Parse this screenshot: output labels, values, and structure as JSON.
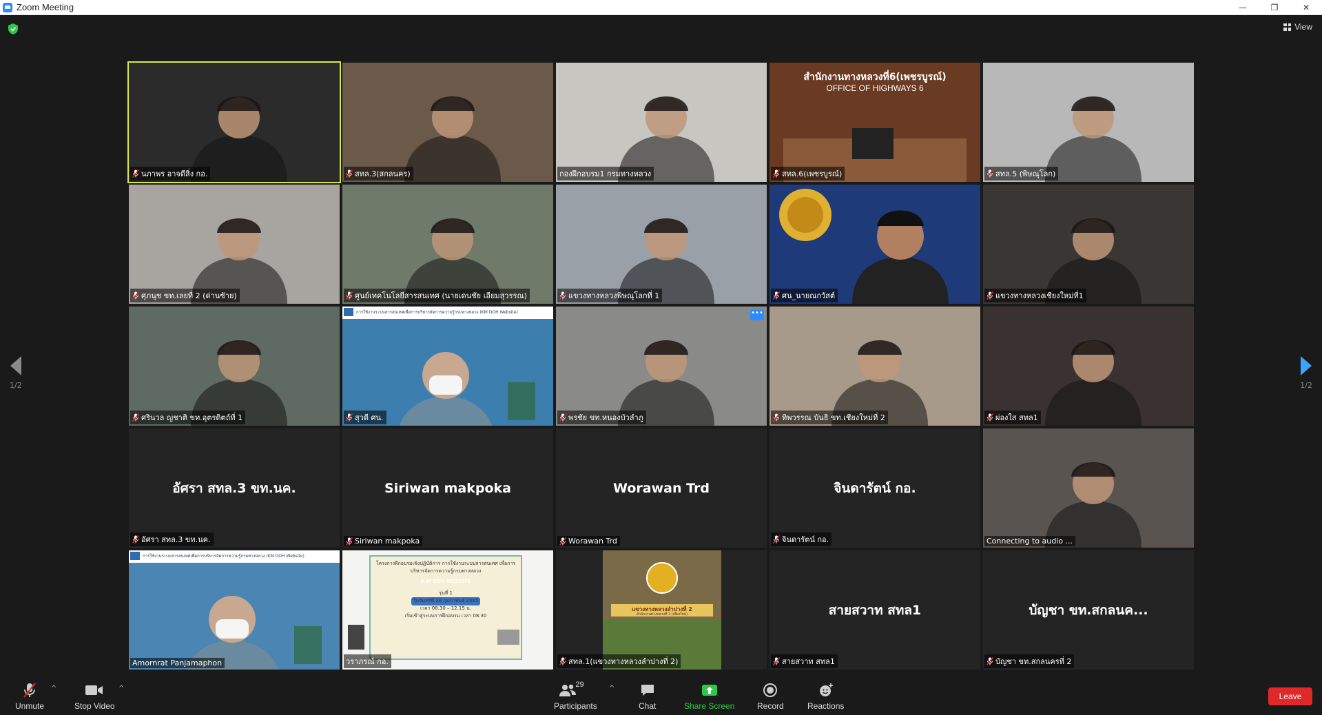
{
  "window": {
    "title": "Zoom Meeting",
    "minimize": "—",
    "restore": "❐",
    "close": "✕"
  },
  "header": {
    "view_label": "View"
  },
  "pager": {
    "left_label": "1/2",
    "right_label": "1/2"
  },
  "tiles": [
    {
      "name": "นภาพร อาจดีสิ่ง กอ.",
      "muted": true,
      "bg": "#2b2b2b",
      "active": true
    },
    {
      "name": "สทล.3(สกลนคร)",
      "muted": true,
      "bg": "#6b5a4a"
    },
    {
      "name": "กองฝึกอบรม1 กรมทางหลวง",
      "muted": false,
      "bg": "#c8c6c0"
    },
    {
      "name": "สทล.6(เพชรบูรณ์)",
      "muted": true,
      "bg": "#6a3a22",
      "sign_line1": "สำนักงานทางหลวงที่6(เพชรบูรณ์)",
      "sign_line2": "OFFICE OF HIGHWAYS 6"
    },
    {
      "name": "สทล.5 (พิษณุโลก)",
      "muted": true,
      "bg": "#b8b8b8"
    },
    {
      "name": "ศุภนุช ขท.เลยที่ 2 (ด่านซ้าย)",
      "muted": true,
      "bg": "#a8a4a0"
    },
    {
      "name": "ศูนย์เทคโนโลยีสารสนเทศ (นายเดนชัย เอียมสุวรรณ)",
      "muted": true,
      "bg": "#6f7a6a"
    },
    {
      "name": "แขวงทางหลวงพิษณุโลกที่ 1",
      "muted": true,
      "bg": "#9aa0a8"
    },
    {
      "name": "ศน_นายณกวัสต์",
      "muted": true,
      "bg": "#1f3a78"
    },
    {
      "name": "แขวงทางหลวงเชียงใหม่ที่1",
      "muted": true,
      "bg": "#3a3634"
    },
    {
      "name": "ศรินวล ญชาติ ขท.อุตรดิตถ์ที่ 1",
      "muted": true,
      "bg": "#5f6b62"
    },
    {
      "name": "สุวดี ศน.",
      "muted": true,
      "bg": "#3c7fae",
      "banner": "การใช้งานระบบสารสนเทศเพื่อการบริหารจัดการความรู้กรมทางหลวง (KM DOH Website)"
    },
    {
      "name": "พรชัย ขท.หนองบัวลำภู",
      "muted": true,
      "bg": "#8a8a88",
      "more": true
    },
    {
      "name": "ทิพวรรณ บันธิ ขท.เชียงใหม่ที่ 2",
      "muted": true,
      "bg": "#a89a8a"
    },
    {
      "name": "ผ่องใส สทล1",
      "muted": true,
      "bg": "#3a3230"
    },
    {
      "name": "อัศรา สทล.3 ขท.นค.",
      "muted": true,
      "bg": "#242424",
      "center": "อัศรา สทล.3 ขท.นค."
    },
    {
      "name": "Siriwan makpoka",
      "muted": true,
      "bg": "#242424",
      "center": "Siriwan makpoka"
    },
    {
      "name": "Worawan Trd",
      "muted": true,
      "bg": "#242424",
      "center": "Worawan Trd"
    },
    {
      "name": "จินดารัตน์ กอ.",
      "muted": true,
      "bg": "#242424",
      "center": "จินดารัตน์ กอ."
    },
    {
      "name": "Connecting to audio ...",
      "muted": false,
      "bg": "#5a5450"
    },
    {
      "name": "Amornrat Panjamaphon",
      "muted": false,
      "bg": "#4a85b4",
      "banner": "การใช้งานระบบสารสนเทศเพื่อการบริหารจัดการความรู้กรมทางหลวง (KM DOH Website)"
    },
    {
      "name": "วราภรณ์ กอ.",
      "muted": false,
      "bg": "#f4f4f2",
      "poster_title": "โครงการฝึกอบรมเชิงปฏิบัติการ การใช้งานระบบสารสนเทศ เพื่อการบริหารจัดการความรู้กรมทางหลวง",
      "poster_site": "K.M DOH WEBSITE",
      "poster_round": "รุ่นที่ 1",
      "poster_date": "วันจันทร์ที่ 28 กุมภาพันธ์ 2565",
      "poster_time": "เวลา 08.30 – 12.15 น.",
      "poster_join": "เริ่มเข้าสู่ระบบการฝึกอบรม เวลา 08.30"
    },
    {
      "name": "สทล.1(แขวงทางหลวงลำปางที่ 2)",
      "muted": true,
      "bg": "#242424",
      "lampang_title": "แขวงทางหลวงลำปางที่ 2",
      "lampang_sub": "สำนักงานทางหลวงที่ 1 (เชียงใหม่)"
    },
    {
      "name": "สายสวาท สทล1",
      "muted": true,
      "bg": "#242424",
      "center": "สายสวาท สทล1"
    },
    {
      "name": "บัญชา ขท.สกลนครที่ 2",
      "muted": true,
      "bg": "#242424",
      "center": "บัญชา ขท.สกลนค..."
    }
  ],
  "toolbar": {
    "unmute_label": "Unmute",
    "stop_video_label": "Stop Video",
    "participants_label": "Participants",
    "participants_count": "29",
    "chat_label": "Chat",
    "share_label": "Share Screen",
    "record_label": "Record",
    "reactions_label": "Reactions",
    "leave_label": "Leave"
  },
  "colors": {
    "accent": "#2d8cff",
    "active_speaker": "#d7e84a",
    "share_green": "#2ec84b",
    "leave_red": "#e02828",
    "muted_red": "#e02828"
  }
}
